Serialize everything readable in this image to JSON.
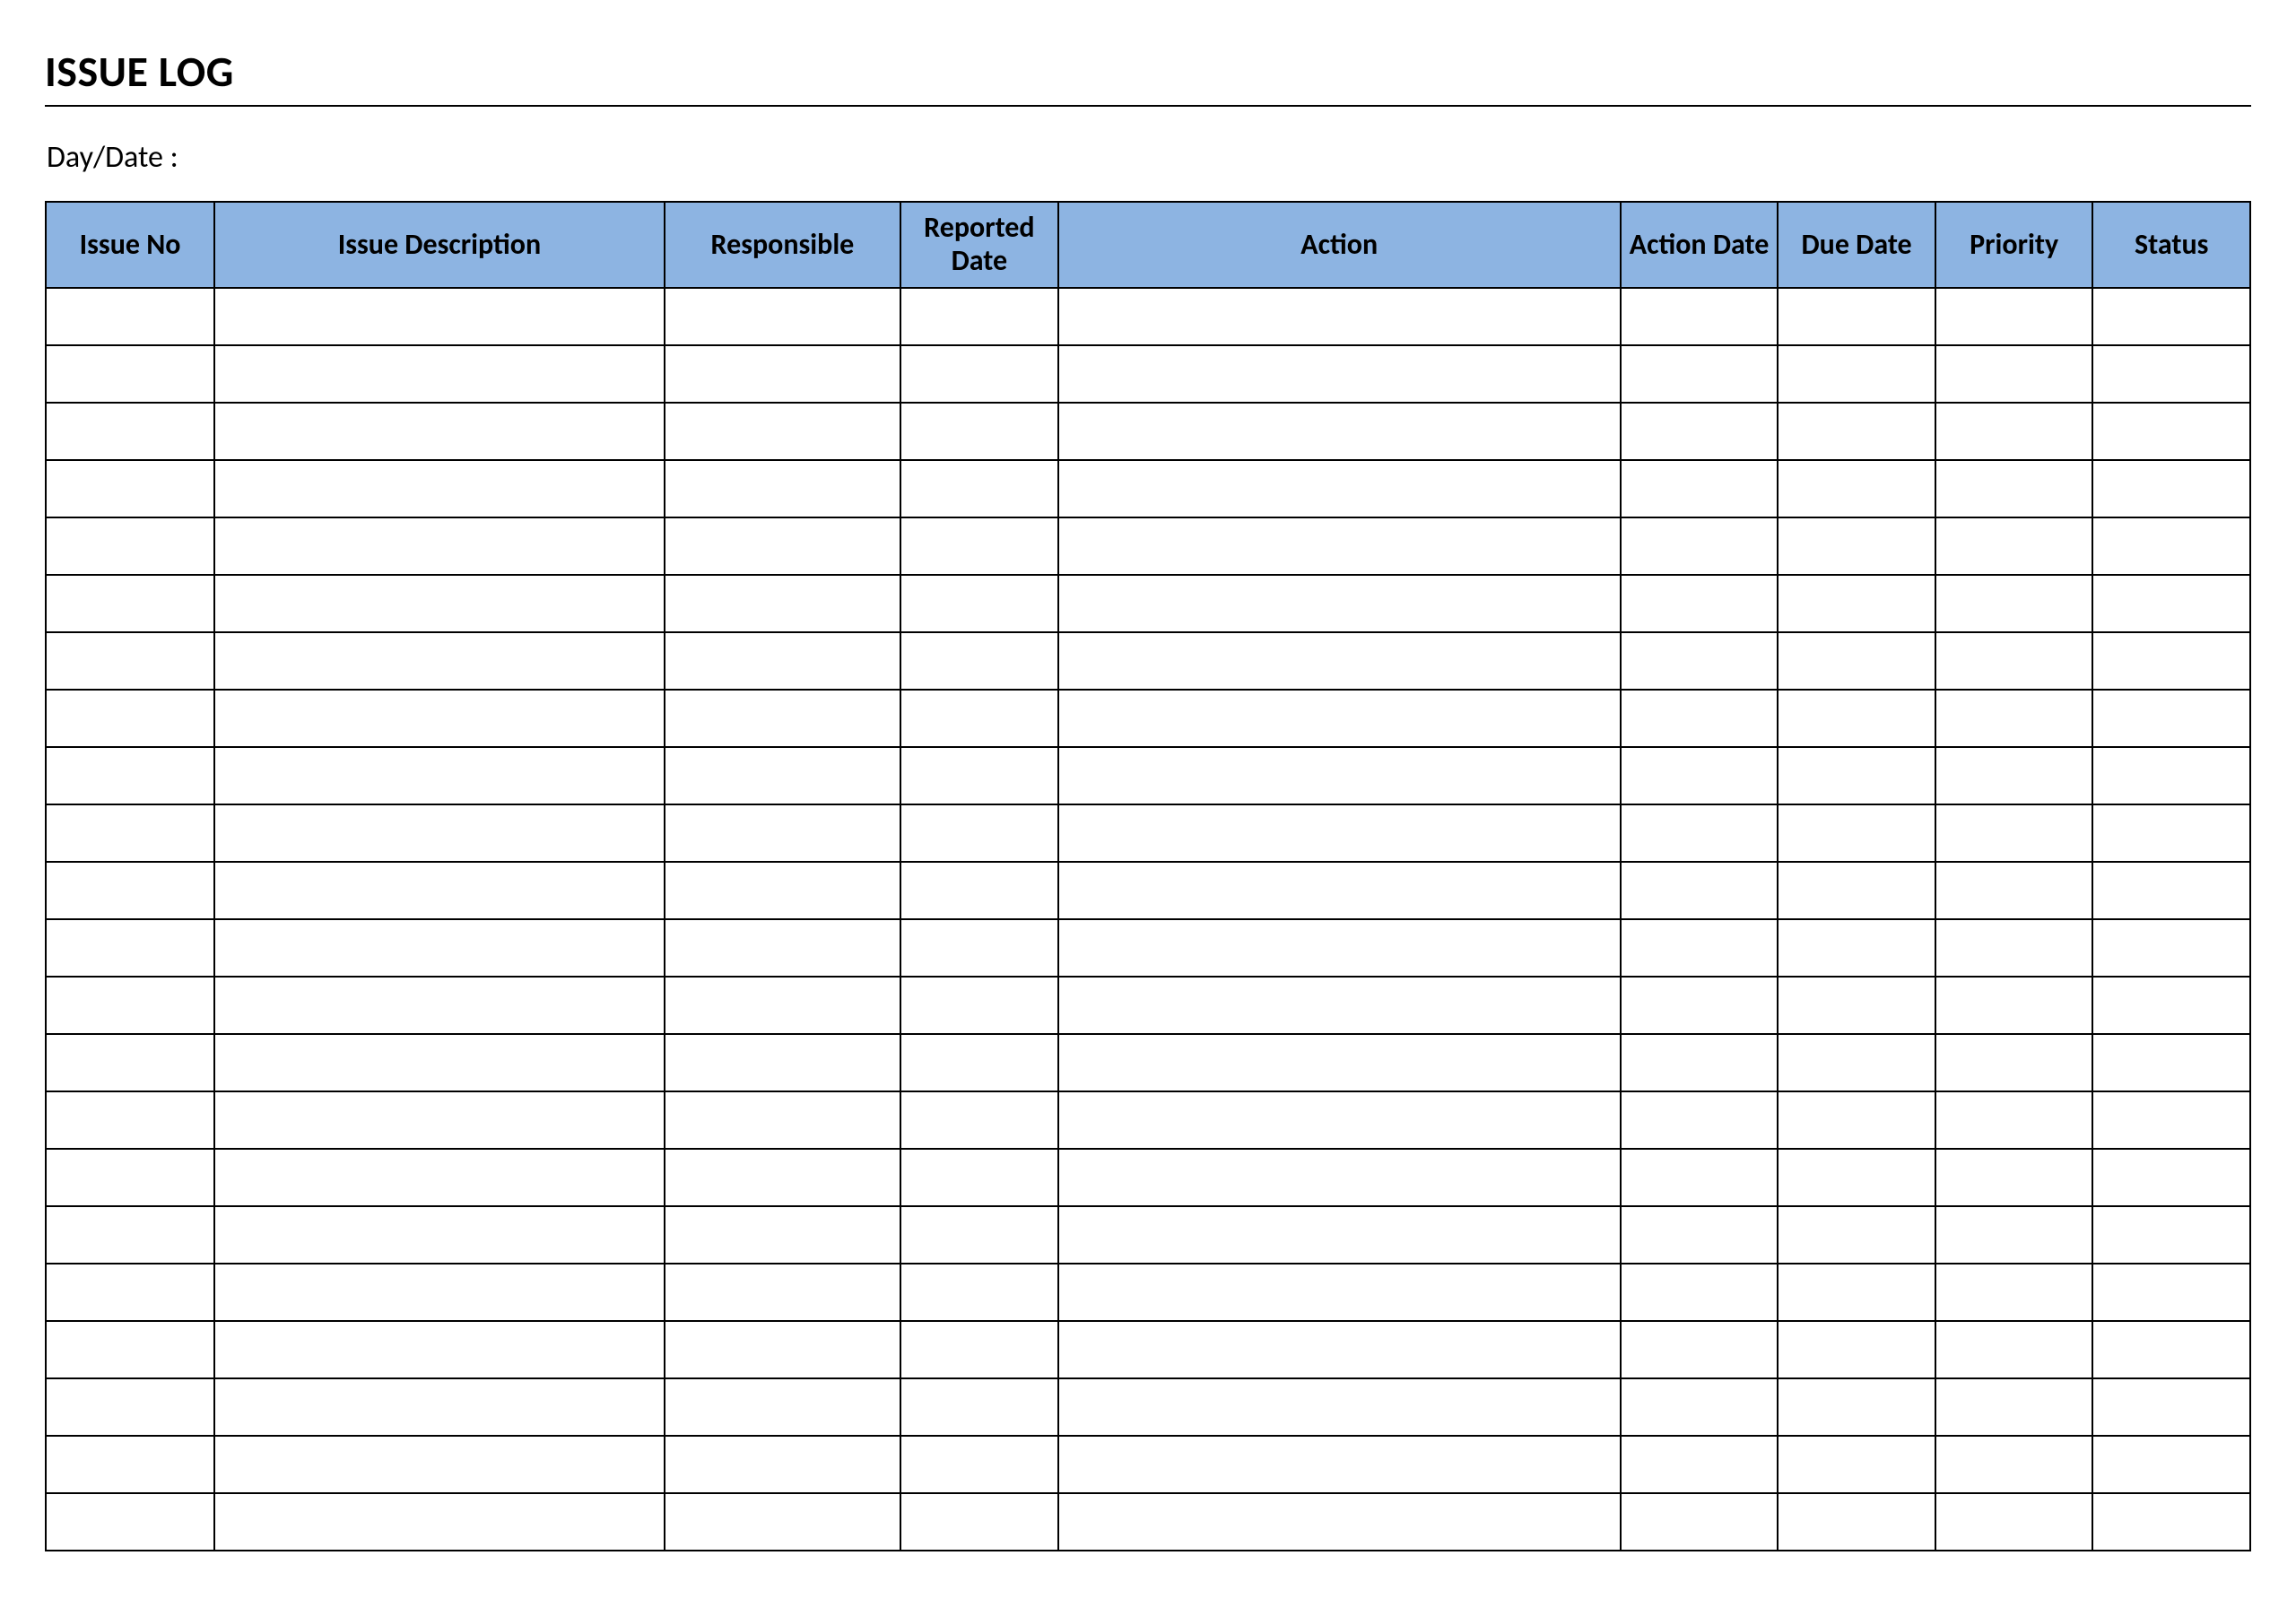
{
  "title": "ISSUE LOG",
  "day_date_label": "Day/Date :",
  "colors": {
    "header_bg": "#8DB4E2",
    "border": "#000000"
  },
  "table": {
    "columns": [
      {
        "label": "Issue No",
        "width_pct": 7.5
      },
      {
        "label": "Issue Description",
        "width_pct": 20
      },
      {
        "label": "Responsible",
        "width_pct": 10.5
      },
      {
        "label": "Reported Date",
        "width_pct": 7
      },
      {
        "label": "Action",
        "width_pct": 25
      },
      {
        "label": "Action Date",
        "width_pct": 7
      },
      {
        "label": "Due Date",
        "width_pct": 7
      },
      {
        "label": "Priority",
        "width_pct": 7
      },
      {
        "label": "Status",
        "width_pct": 7
      }
    ],
    "rows": [
      [
        "",
        "",
        "",
        "",
        "",
        "",
        "",
        "",
        ""
      ],
      [
        "",
        "",
        "",
        "",
        "",
        "",
        "",
        "",
        ""
      ],
      [
        "",
        "",
        "",
        "",
        "",
        "",
        "",
        "",
        ""
      ],
      [
        "",
        "",
        "",
        "",
        "",
        "",
        "",
        "",
        ""
      ],
      [
        "",
        "",
        "",
        "",
        "",
        "",
        "",
        "",
        ""
      ],
      [
        "",
        "",
        "",
        "",
        "",
        "",
        "",
        "",
        ""
      ],
      [
        "",
        "",
        "",
        "",
        "",
        "",
        "",
        "",
        ""
      ],
      [
        "",
        "",
        "",
        "",
        "",
        "",
        "",
        "",
        ""
      ],
      [
        "",
        "",
        "",
        "",
        "",
        "",
        "",
        "",
        ""
      ],
      [
        "",
        "",
        "",
        "",
        "",
        "",
        "",
        "",
        ""
      ],
      [
        "",
        "",
        "",
        "",
        "",
        "",
        "",
        "",
        ""
      ],
      [
        "",
        "",
        "",
        "",
        "",
        "",
        "",
        "",
        ""
      ],
      [
        "",
        "",
        "",
        "",
        "",
        "",
        "",
        "",
        ""
      ],
      [
        "",
        "",
        "",
        "",
        "",
        "",
        "",
        "",
        ""
      ],
      [
        "",
        "",
        "",
        "",
        "",
        "",
        "",
        "",
        ""
      ],
      [
        "",
        "",
        "",
        "",
        "",
        "",
        "",
        "",
        ""
      ],
      [
        "",
        "",
        "",
        "",
        "",
        "",
        "",
        "",
        ""
      ],
      [
        "",
        "",
        "",
        "",
        "",
        "",
        "",
        "",
        ""
      ],
      [
        "",
        "",
        "",
        "",
        "",
        "",
        "",
        "",
        ""
      ],
      [
        "",
        "",
        "",
        "",
        "",
        "",
        "",
        "",
        ""
      ],
      [
        "",
        "",
        "",
        "",
        "",
        "",
        "",
        "",
        ""
      ],
      [
        "",
        "",
        "",
        "",
        "",
        "",
        "",
        "",
        ""
      ]
    ]
  }
}
